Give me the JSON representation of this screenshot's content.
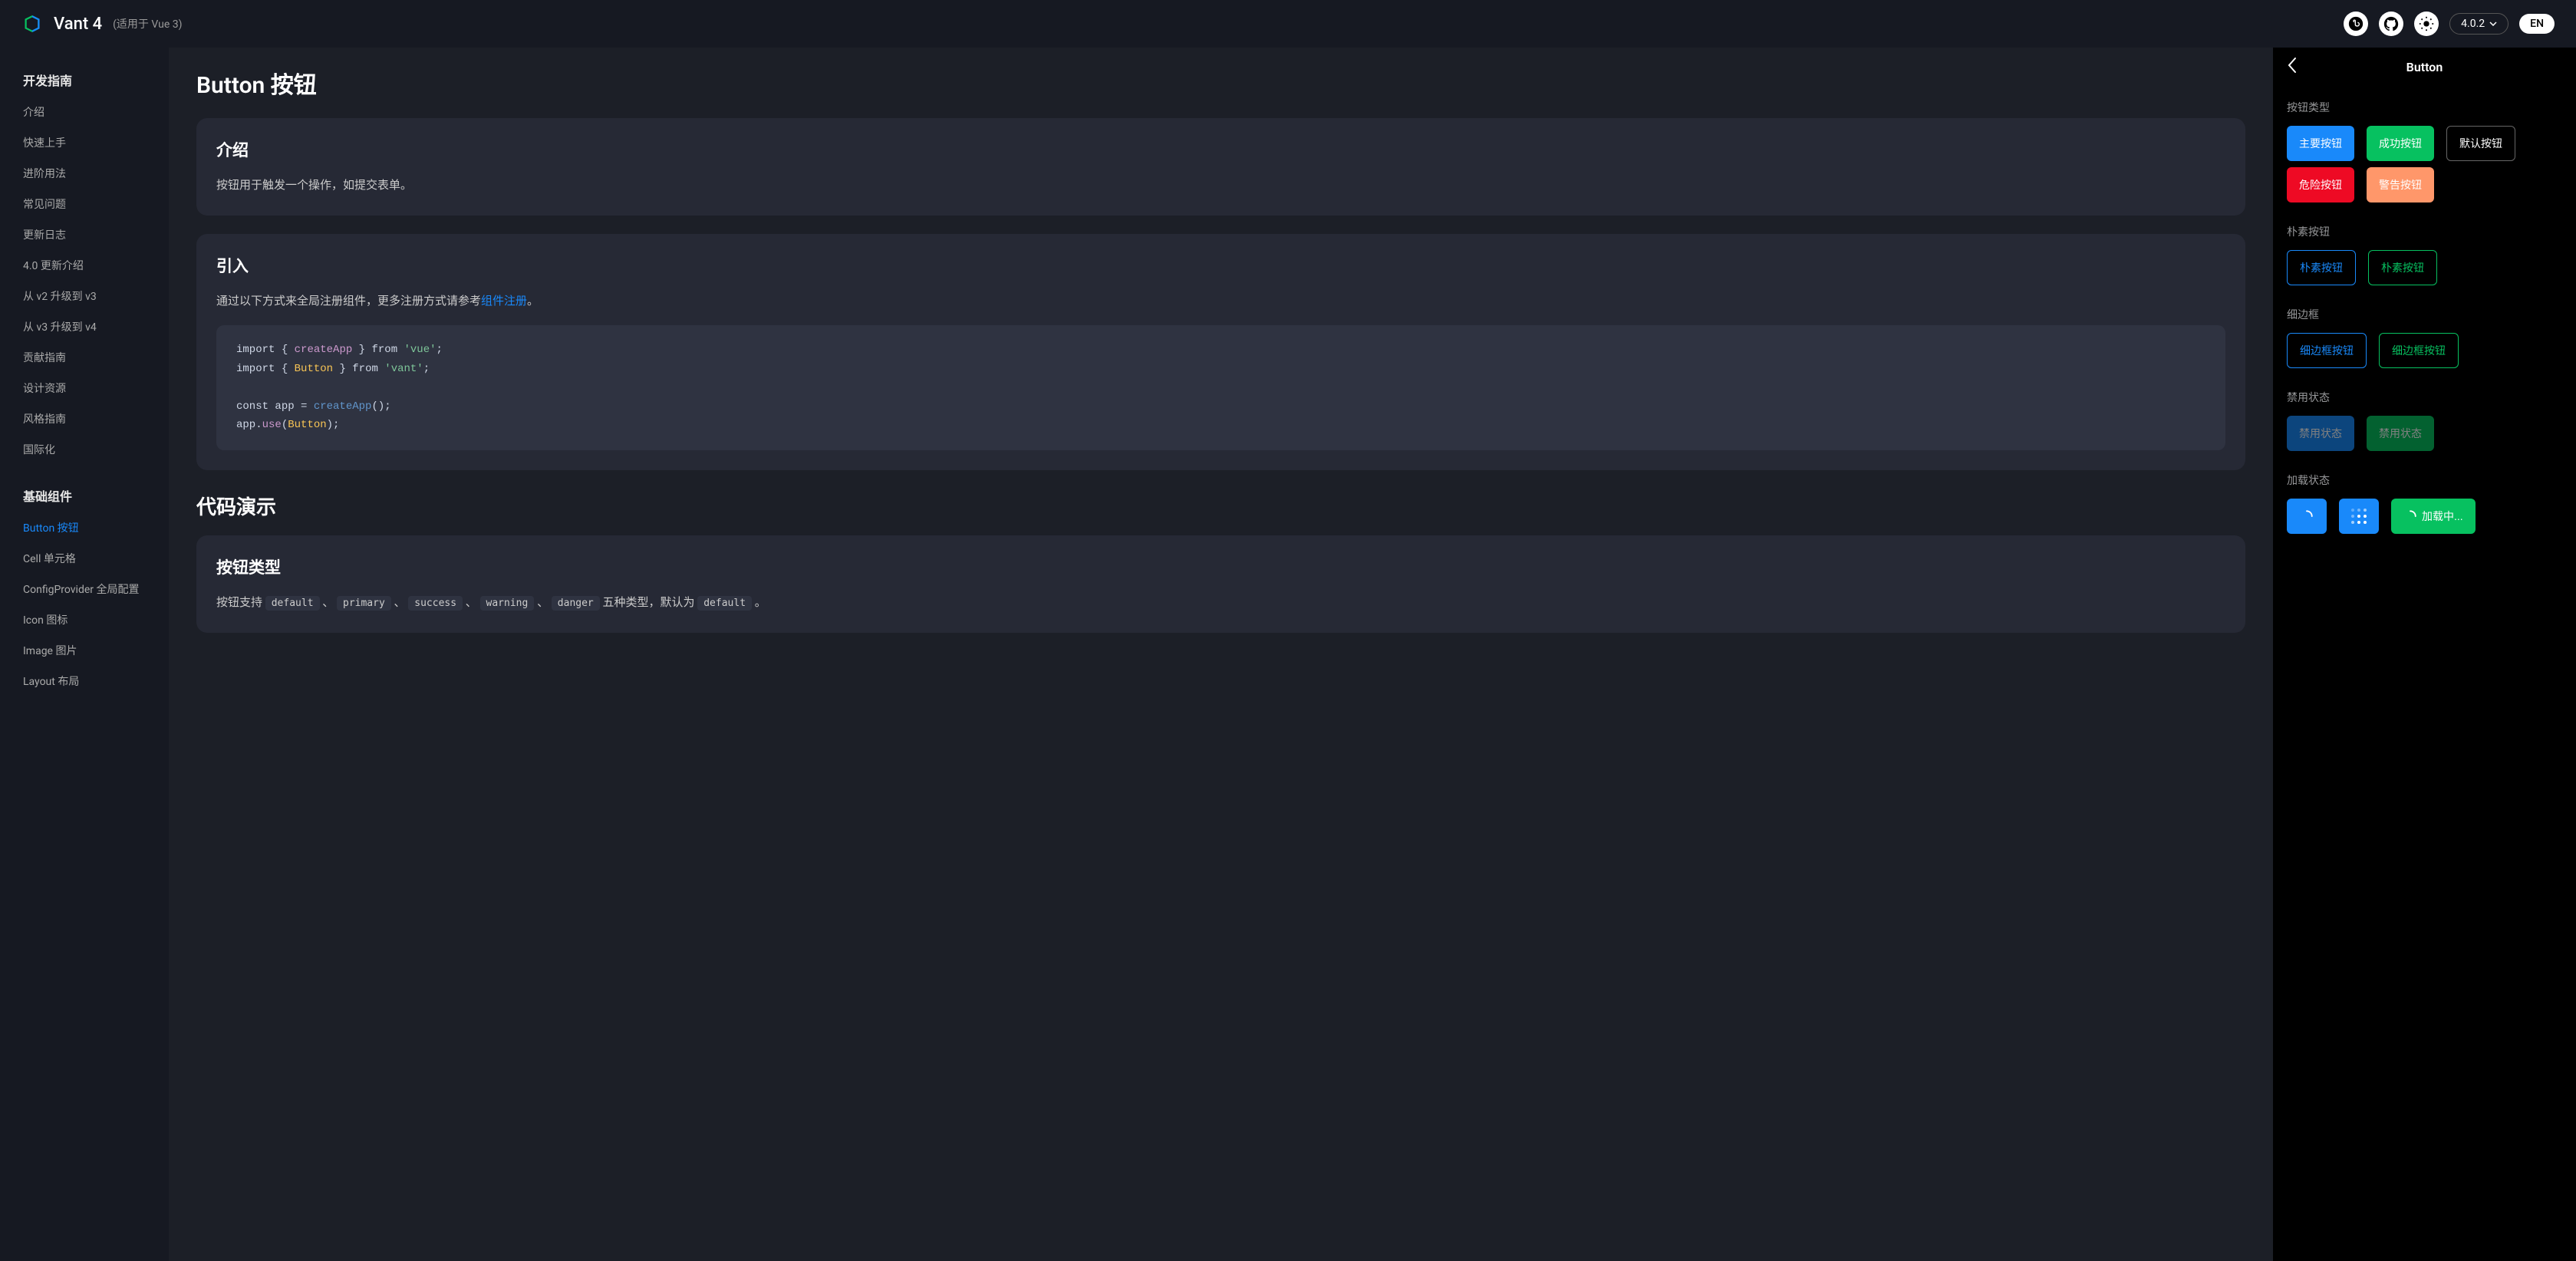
{
  "header": {
    "app_title": "Vant 4",
    "app_subtitle": "(适用于 Vue 3)",
    "version": "4.0.2",
    "lang": "EN"
  },
  "sidebar": {
    "sections": [
      {
        "title": "开发指南",
        "items": [
          {
            "label": "介绍",
            "active": false
          },
          {
            "label": "快速上手",
            "active": false
          },
          {
            "label": "进阶用法",
            "active": false
          },
          {
            "label": "常见问题",
            "active": false
          },
          {
            "label": "更新日志",
            "active": false
          },
          {
            "label": "4.0 更新介绍",
            "active": false
          },
          {
            "label": "从 v2 升级到 v3",
            "active": false
          },
          {
            "label": "从 v3 升级到 v4",
            "active": false
          },
          {
            "label": "贡献指南",
            "active": false
          },
          {
            "label": "设计资源",
            "active": false
          },
          {
            "label": "风格指南",
            "active": false
          },
          {
            "label": "国际化",
            "active": false
          }
        ]
      },
      {
        "title": "基础组件",
        "items": [
          {
            "label": "Button 按钮",
            "active": true
          },
          {
            "label": "Cell 单元格",
            "active": false
          },
          {
            "label": "ConfigProvider 全局配置",
            "active": false
          },
          {
            "label": "Icon 图标",
            "active": false
          },
          {
            "label": "Image 图片",
            "active": false
          },
          {
            "label": "Layout 布局",
            "active": false
          }
        ]
      }
    ]
  },
  "main": {
    "page_title": "Button 按钮",
    "intro_heading": "介绍",
    "intro_text": "按钮用于触发一个操作，如提交表单。",
    "import_heading": "引入",
    "import_text_prefix": "通过以下方式来全局注册组件，更多注册方式请参考",
    "import_link": "组件注册",
    "import_text_suffix": "。",
    "code": {
      "line1_import": "import",
      "line1_brace_open": " { ",
      "line1_fn": "createApp",
      "line1_brace_close": " } ",
      "line1_from": "from ",
      "line1_pkg": "'vue'",
      "line1_semi": ";",
      "line2_import": "import",
      "line2_brace_open": " { ",
      "line2_cls": "Button",
      "line2_brace_close": " } ",
      "line2_from": "from ",
      "line2_pkg": "'vant'",
      "line2_semi": ";",
      "line4_const": "const",
      "line4_app": " app = ",
      "line4_fn": "createApp",
      "line4_paren": "();",
      "line5_pre": "app.",
      "line5_use": "use",
      "line5_open": "(",
      "line5_cls": "Button",
      "line5_close": ");"
    },
    "demo_heading": "代码演示",
    "type_card_heading": "按钮类型",
    "type_card_text_1": "按钮支持 ",
    "type_card_code_1": "default",
    "type_card_sep": " 、 ",
    "type_card_code_2": "primary",
    "type_card_code_3": "success",
    "type_card_code_4": "warning",
    "type_card_code_5": "danger",
    "type_card_text_2": " 五种类型，默认为 ",
    "type_card_code_6": "default",
    "type_card_text_3": " 。"
  },
  "preview": {
    "title": "Button",
    "sections": {
      "types": {
        "title": "按钮类型",
        "buttons": [
          "主要按钮",
          "成功按钮",
          "默认按钮",
          "危险按钮",
          "警告按钮"
        ]
      },
      "plain": {
        "title": "朴素按钮",
        "buttons": [
          "朴素按钮",
          "朴素按钮"
        ]
      },
      "hairline": {
        "title": "细边框",
        "buttons": [
          "细边框按钮",
          "细边框按钮"
        ]
      },
      "disabled": {
        "title": "禁用状态",
        "buttons": [
          "禁用状态",
          "禁用状态"
        ]
      },
      "loading": {
        "title": "加载状态",
        "loading_text": "加载中..."
      }
    }
  }
}
